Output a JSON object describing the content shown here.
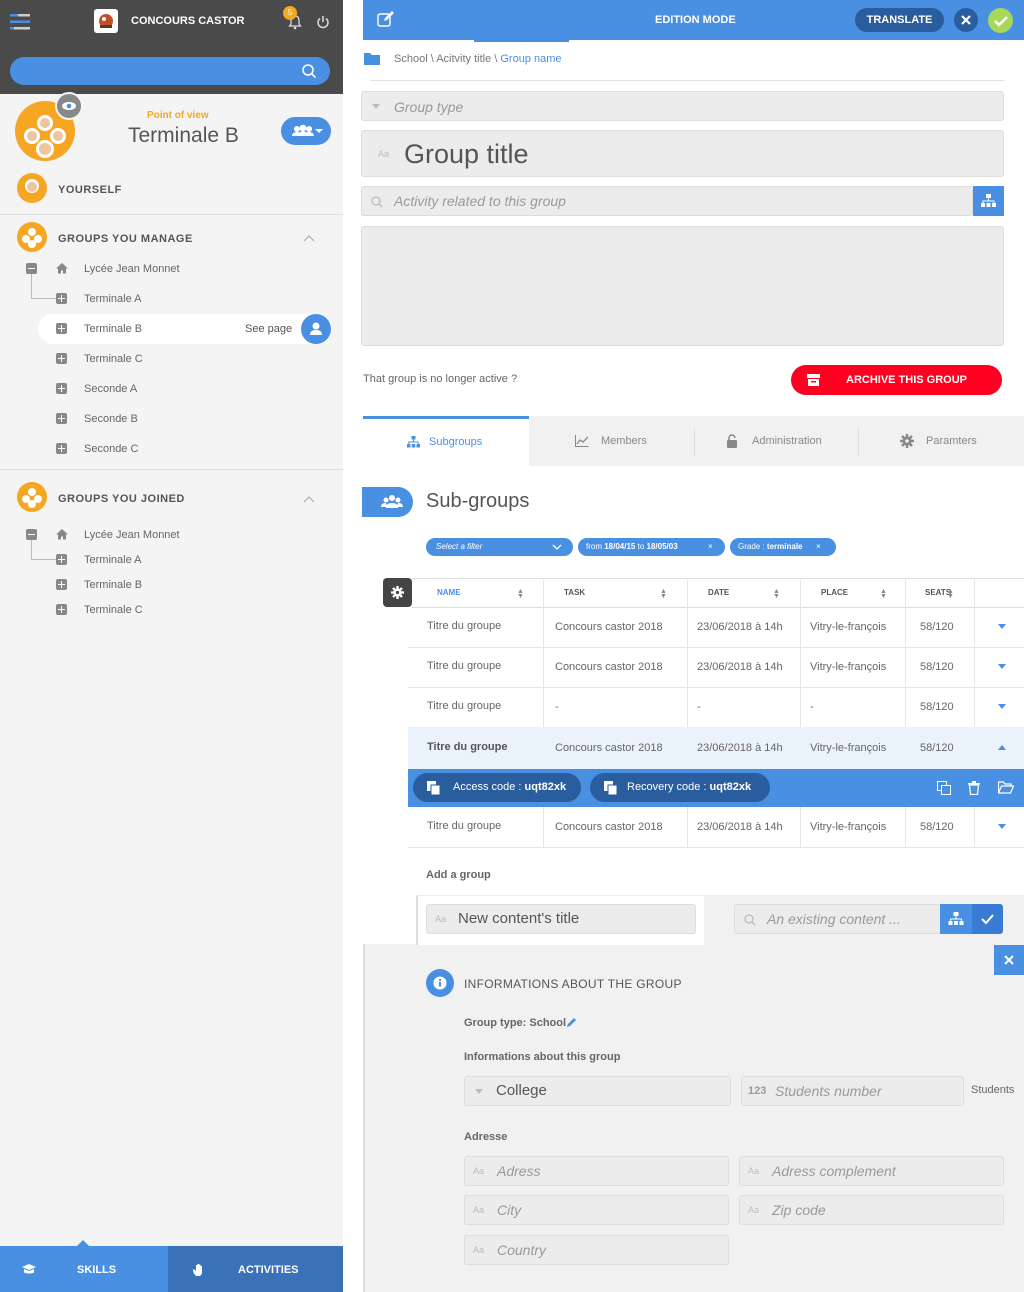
{
  "app": {
    "name": "CONCOURS CASTOR",
    "notifications": "5"
  },
  "sidebar": {
    "point_of_view_label": "Point of view",
    "point_of_view_value": "Terminale B",
    "yourself": "YOURSELF",
    "manage_title": "GROUPS YOU MANAGE",
    "manage_items": [
      "Lycée Jean Monnet",
      "Terminale A",
      "Terminale B",
      "Terminale C",
      "Seconde A",
      "Seconde B",
      "Seconde C"
    ],
    "see_page": "See page",
    "joined_title": "GROUPS YOU JOINED",
    "joined_items": [
      "Lycée Jean Monnet",
      "Terminale A",
      "Terminale B",
      "Terminale C"
    ],
    "bottom_tabs": [
      "SKILLS",
      "ACTIVITIES"
    ]
  },
  "header": {
    "mode": "EDITION MODE",
    "translate": "TRANSLATE"
  },
  "breadcrumb": {
    "path": "School \\ Acitvity title \\ ",
    "current": "Group name"
  },
  "form": {
    "group_type_placeholder": "Group type",
    "title_placeholder": "Group title",
    "activity_placeholder": "Activity related to this group",
    "inactive_text": "That group is no longer active ?",
    "archive_label": "ARCHIVE THIS GROUP",
    "aa": "Aa"
  },
  "tabs": [
    "Subgroups",
    "Members",
    "Administration",
    "Paramters"
  ],
  "subgroups": {
    "title": "Sub-groups",
    "filter_placeholder": "Select a filter",
    "filter_date": {
      "from_lbl": "from",
      "from": "18/04/15",
      "to_lbl": "to",
      "to": "18/05/03"
    },
    "filter_grade": {
      "lbl": "Grade :",
      "val": "terminale"
    },
    "columns": [
      "NAME",
      "TASK",
      "DATE",
      "PLACE",
      "SEATS"
    ],
    "rows": [
      [
        "Titre du groupe",
        "Concours castor 2018",
        "23/06/2018 à 14h",
        "Vitry-le-françois",
        "58/120"
      ],
      [
        "Titre du groupe",
        "Concours castor 2018",
        "23/06/2018 à 14h",
        "Vitry-le-françois",
        "58/120"
      ],
      [
        "Titre du groupe",
        "-",
        "-",
        "-",
        "58/120"
      ],
      [
        "Titre du groupe",
        "Concours castor 2018",
        "23/06/2018 à 14h",
        "Vitry-le-françois",
        "58/120"
      ],
      [
        "Titre du groupe",
        "Concours castor 2018",
        "23/06/2018 à 14h",
        "Vitry-le-françois",
        "58/120"
      ]
    ],
    "access_label": "Access code :",
    "access_code": "uqt82xk",
    "recovery_label": "Recovery code :",
    "recovery_code": "uqt82xk",
    "add_group": "Add a group",
    "new_content_placeholder": "New content's title",
    "existing_placeholder": "An existing content ..."
  },
  "info": {
    "title": "INFORMATIONS ABOUT THE GROUP",
    "group_type": "Group type: School",
    "about": "Informations about this group",
    "college": "College",
    "students_prefix": "123",
    "students_placeholder": "Students number",
    "students_unit": "Students",
    "address_title": "Adresse",
    "adress": "Adress",
    "adress_complement": "Adress complement",
    "city": "City",
    "zip": "Zip code",
    "country": "Country"
  },
  "colors": {
    "blue": "#4a90e2",
    "dark": "#4a4a4a",
    "red": "#ff0021",
    "orange": "#f5a623",
    "green": "#a7d85a"
  }
}
